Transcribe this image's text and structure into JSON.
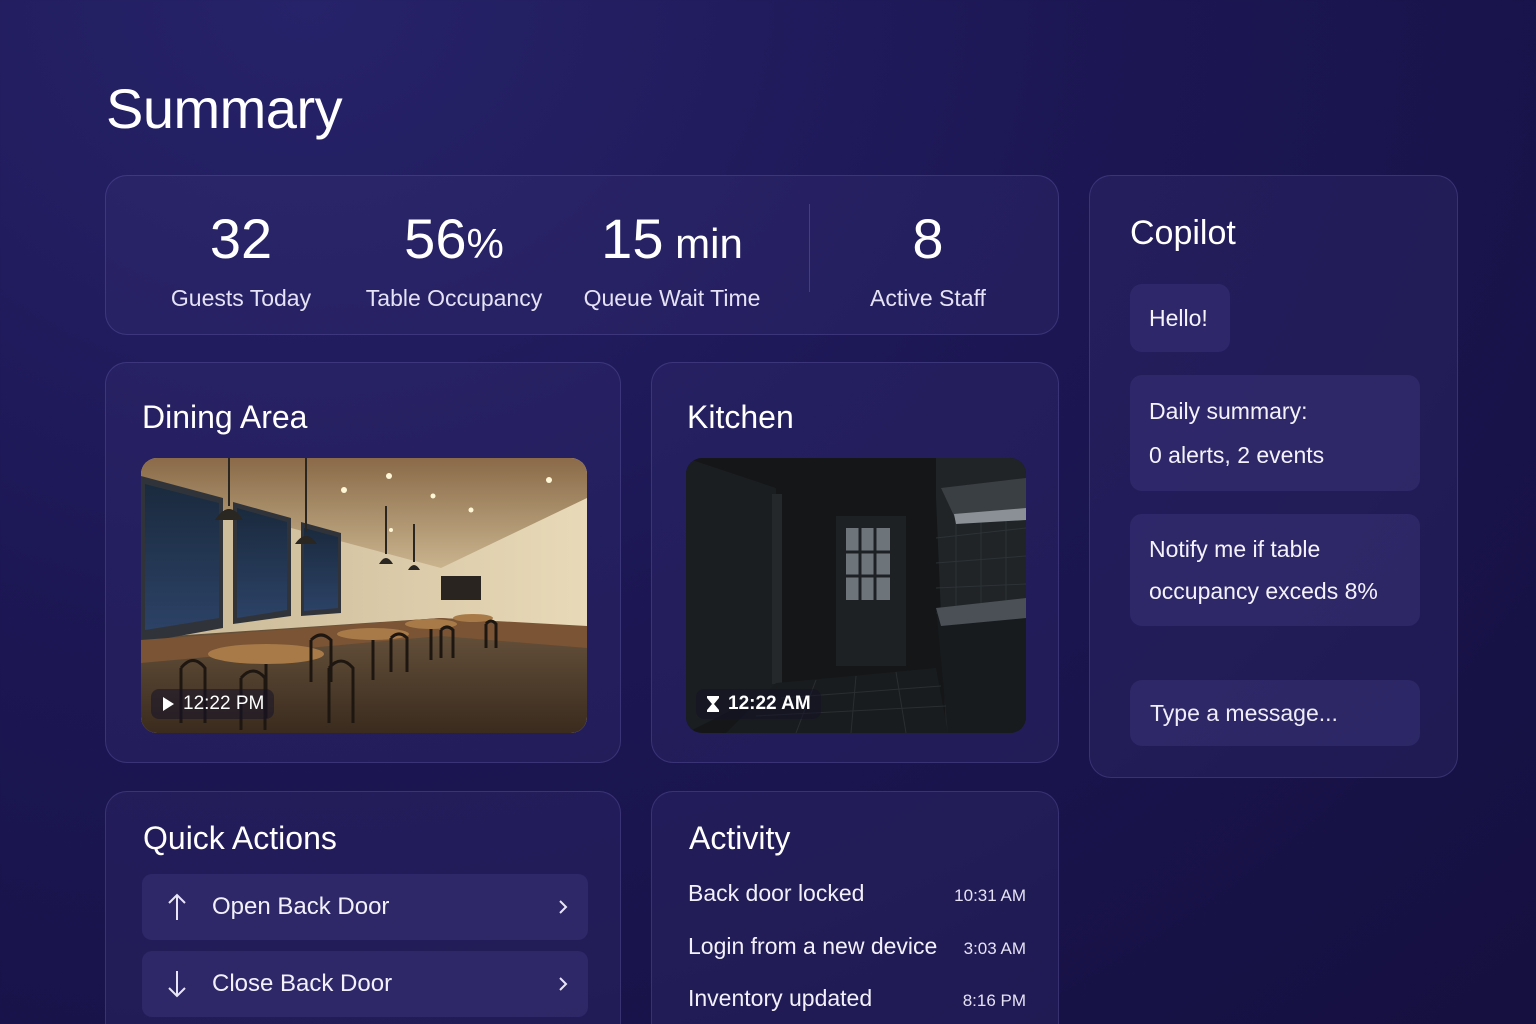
{
  "page": {
    "title": "Summary"
  },
  "stats": [
    {
      "value": "32",
      "unit": "",
      "label": "Guests Today"
    },
    {
      "value": "56",
      "unit": "%",
      "label": "Table Occupancy"
    },
    {
      "value": "15",
      "unit": " min",
      "label": "Queue Wait Time"
    },
    {
      "value": "8",
      "unit": "",
      "label": "Active Staff"
    }
  ],
  "dining": {
    "title": "Dining Area",
    "time": "12:22 PM",
    "icon": "play-icon"
  },
  "kitchen": {
    "title": "Kitchen",
    "time": "12:22 AM",
    "icon": "hourglass-icon"
  },
  "quick_actions": {
    "title": "Quick Actions",
    "items": [
      {
        "label": "Open Back Door",
        "icon": "arrow-up-icon"
      },
      {
        "label": "Close Back Door",
        "icon": "arrow-down-icon"
      }
    ]
  },
  "activity": {
    "title": "Activity",
    "items": [
      {
        "event": "Back door locked",
        "time": "10:31 AM"
      },
      {
        "event": "Login from a new device",
        "time": "3:03 AM"
      },
      {
        "event": "Inventory updated",
        "time": "8:16 PM"
      }
    ]
  },
  "copilot": {
    "title": "Copilot",
    "messages": [
      {
        "lines": [
          "Hello!"
        ]
      },
      {
        "lines": [
          "Daily summary:",
          "0 alerts, 2 events"
        ]
      },
      {
        "lines": [
          "Notify me if table",
          "occupancy exceds 8%"
        ]
      }
    ],
    "input_placeholder": "Type a message..."
  }
}
